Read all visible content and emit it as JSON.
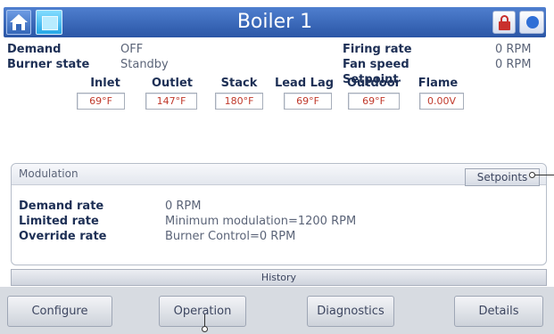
{
  "titlebar": {
    "title": "Boiler 1",
    "home_icon": "home-icon",
    "tile_icon": "dashboard-tile-icon",
    "lock_icon": "lock-icon",
    "info_icon": "info-icon",
    "colors": {
      "bar": "#3a6bbf",
      "lock": "#c9302c"
    }
  },
  "status": {
    "demand_label": "Demand",
    "demand_value": "OFF",
    "burner_state_label": "Burner state",
    "burner_state_value": "Standby",
    "firing_rate_label": "Firing rate",
    "firing_rate_value": "0 RPM",
    "fan_speed_label": "Fan speed",
    "fan_speed_value": "0 RPM",
    "setpoint_label": "Setpoint"
  },
  "temperatures": [
    {
      "label": "Inlet",
      "value": "69°F"
    },
    {
      "label": "Outlet",
      "value": "147°F"
    },
    {
      "label": "Stack",
      "value": "180°F"
    },
    {
      "label": "Lead Lag",
      "value": "69°F"
    },
    {
      "label": "Outdoor",
      "value": "69°F"
    },
    {
      "label": "Flame",
      "value": "0.00V"
    }
  ],
  "modulation": {
    "title": "Modulation",
    "setpoints_button": "Setpoints",
    "rows": [
      {
        "label": "Demand rate",
        "value": "0 RPM"
      },
      {
        "label": "Limited rate",
        "value": "Minimum modulation=1200 RPM"
      },
      {
        "label": "Override rate",
        "value": "Burner Control=0 RPM"
      }
    ]
  },
  "history": {
    "label": "History"
  },
  "nav": {
    "configure": "Configure",
    "operation": "Operation",
    "diagnostics": "Diagnostics",
    "details": "Details"
  }
}
